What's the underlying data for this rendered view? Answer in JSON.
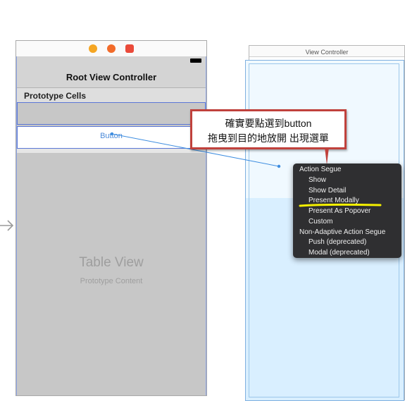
{
  "root_scene": {
    "nav_title": "Root View Controller",
    "prototype_cells_label": "Prototype Cells",
    "cell_button_label": "Button",
    "table_view_title": "Table View",
    "table_view_subtitle": "Prototype Content"
  },
  "dest_scene": {
    "title": "View Controller"
  },
  "callout": {
    "line1": "確實要點選到button",
    "line2": "拖曳到目的地放開 出現選單",
    "border_color": "#c0413c"
  },
  "segue_menu": {
    "action_header": "Action Segue",
    "action_items": [
      "Show",
      "Show Detail",
      "Present Modally",
      "Present As Popover",
      "Custom"
    ],
    "non_adaptive_header": "Non-Adaptive Action Segue",
    "non_adaptive_items": [
      "Push (deprecated)",
      "Modal (deprecated)"
    ],
    "highlighted_item": "Present Modally",
    "highlight_color": "#f5f000"
  },
  "colors": {
    "dock_icon_yellow": "#f5a623",
    "dock_icon_orange": "#f26b2a",
    "dock_icon_red": "#ea4a3a",
    "selection_blue": "#5b77d6",
    "drag_line_blue": "#3d8de0"
  }
}
